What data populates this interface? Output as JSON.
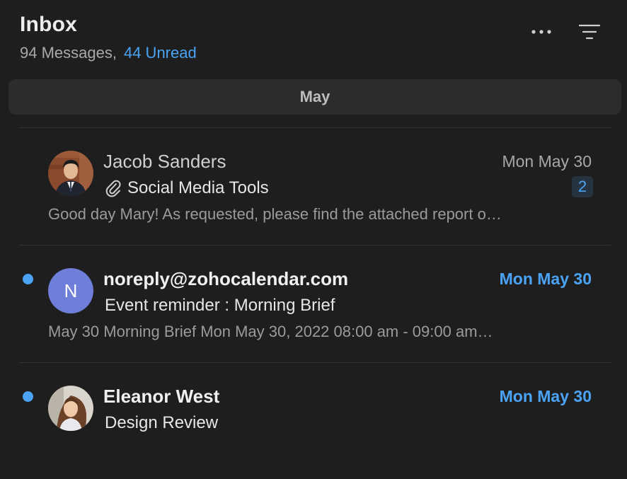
{
  "header": {
    "title": "Inbox",
    "count": "94 Messages,",
    "unread": "44 Unread",
    "more_icon": "ellipsis-icon",
    "filter_icon": "filter-icon"
  },
  "section": {
    "label": "May"
  },
  "colors": {
    "background": "#1e1e1f",
    "accent": "#4aa3f5",
    "section_bg": "#2c2c2d",
    "avatar_initial_bg": "#6f7ed8"
  },
  "messages": [
    {
      "sender": "Jacob Sanders",
      "date": "Mon May 30",
      "subject": "Social Media Tools",
      "has_attachment": true,
      "thread_count": "2",
      "preview": "Good day Mary! As requested, please find the attached report o…",
      "unread": false
    },
    {
      "sender": "noreply@zohocalendar.com",
      "avatar_initial": "N",
      "date": "Mon May 30",
      "subject": "Event reminder : Morning Brief",
      "preview": "May 30 Morning Brief Mon May 30, 2022 08:00 am - 09:00 am…",
      "unread": true
    },
    {
      "sender": "Eleanor West",
      "date": "Mon May 30",
      "subject": "Design Review",
      "preview": "",
      "unread": true
    }
  ]
}
